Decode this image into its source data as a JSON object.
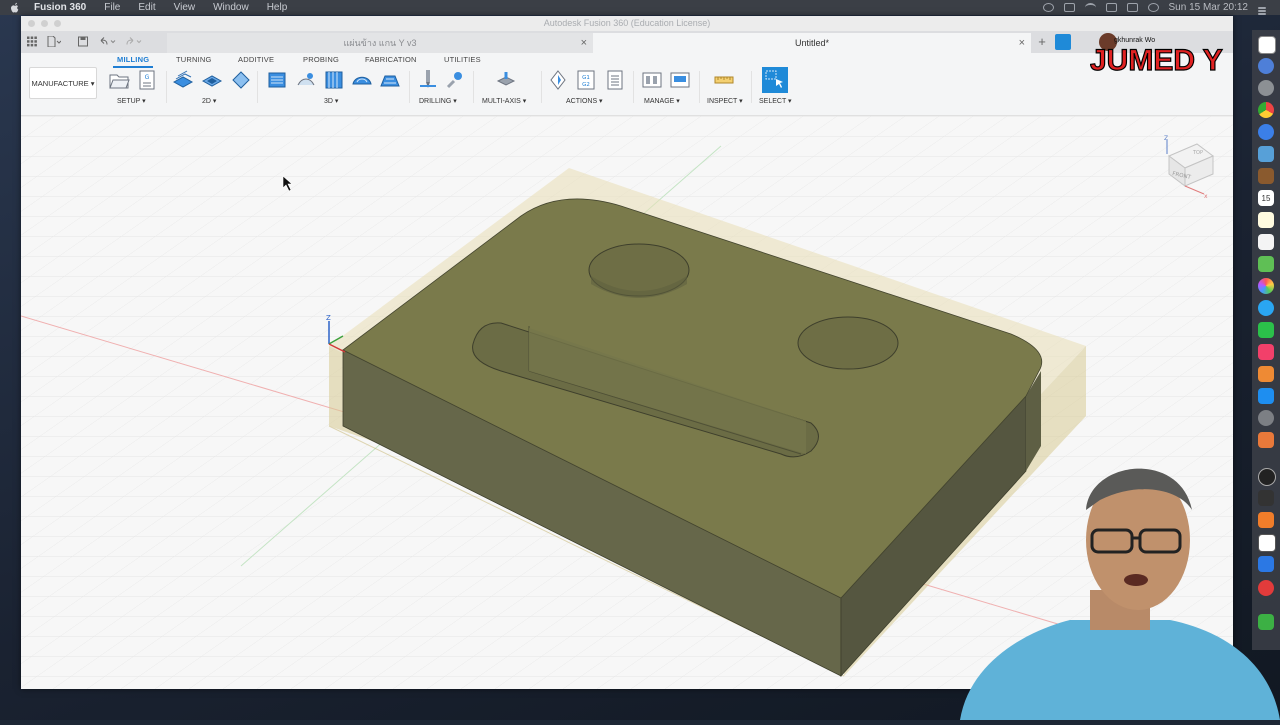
{
  "menubar": {
    "app_name": "Fusion 360",
    "items": [
      "File",
      "Edit",
      "View",
      "Window",
      "Help"
    ],
    "clock": "Sun 15 Mar  20:12"
  },
  "window": {
    "title": "Autodesk Fusion 360 (Education License)"
  },
  "tabs": [
    {
      "label": "แผ่นข้าง แกน Y v3",
      "close": "×"
    },
    {
      "label": "Untitled*",
      "close": "×"
    }
  ],
  "toolbar": {
    "workspace": "MANUFACTURE ▾",
    "categories": [
      "MILLING",
      "TURNING",
      "ADDITIVE",
      "PROBING",
      "FABRICATION",
      "UTILITIES"
    ],
    "groups": [
      "SETUP ▾",
      "2D ▾",
      "3D ▾",
      "DRILLING ▾",
      "MULTI-AXIS ▾",
      "ACTIONS ▾",
      "MANAGE ▾",
      "INSPECT ▾",
      "SELECT ▾"
    ],
    "nc_badge": "G1\nG2",
    "setup_badge": "G"
  },
  "viewcube": {
    "face": "FRONT",
    "top": "TOP",
    "axis_z": "Z"
  },
  "origin_axis": {
    "z": "Z"
  },
  "overlay": {
    "logo_text": "JUMED Y",
    "streamer_name": "gkhunrak Wo"
  },
  "dock_calendar": "15",
  "colors": {
    "accent": "#1f7ed3",
    "model_top": "#7a7a4b",
    "model_side": "#636444",
    "stock": "#d9cc95"
  }
}
